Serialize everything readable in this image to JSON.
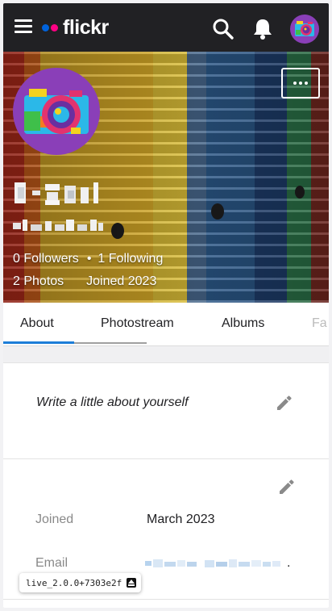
{
  "header": {
    "logo_text": "flickr",
    "menu_icon": "hamburger-menu-icon",
    "search_icon": "search-icon",
    "notifications_icon": "bell-icon",
    "colors": {
      "bar": "#212124",
      "logo_blue": "#0063dc",
      "logo_pink": "#ff0084"
    }
  },
  "profile": {
    "followers": "0 Followers",
    "separator": "•",
    "following": "1 Following",
    "photos": "2 Photos",
    "joined": "Joined 2023",
    "more_icon": "more-options-icon"
  },
  "tabs": [
    {
      "label": "About",
      "active": true
    },
    {
      "label": "Photostream",
      "active": false
    },
    {
      "label": "Albums",
      "active": false
    },
    {
      "label": "Fa",
      "active": false
    }
  ],
  "about": {
    "description_placeholder": "Write a little about yourself",
    "edit_icon": "pencil-edit-icon"
  },
  "details": {
    "joined_label": "Joined",
    "joined_value": "March 2023",
    "email_label": "Email",
    "email_suffix": "."
  },
  "build": {
    "version": "live_2.0.0+7303e2f",
    "icon": "eject-icon"
  },
  "colors": {
    "accent": "#1c7dd8"
  }
}
